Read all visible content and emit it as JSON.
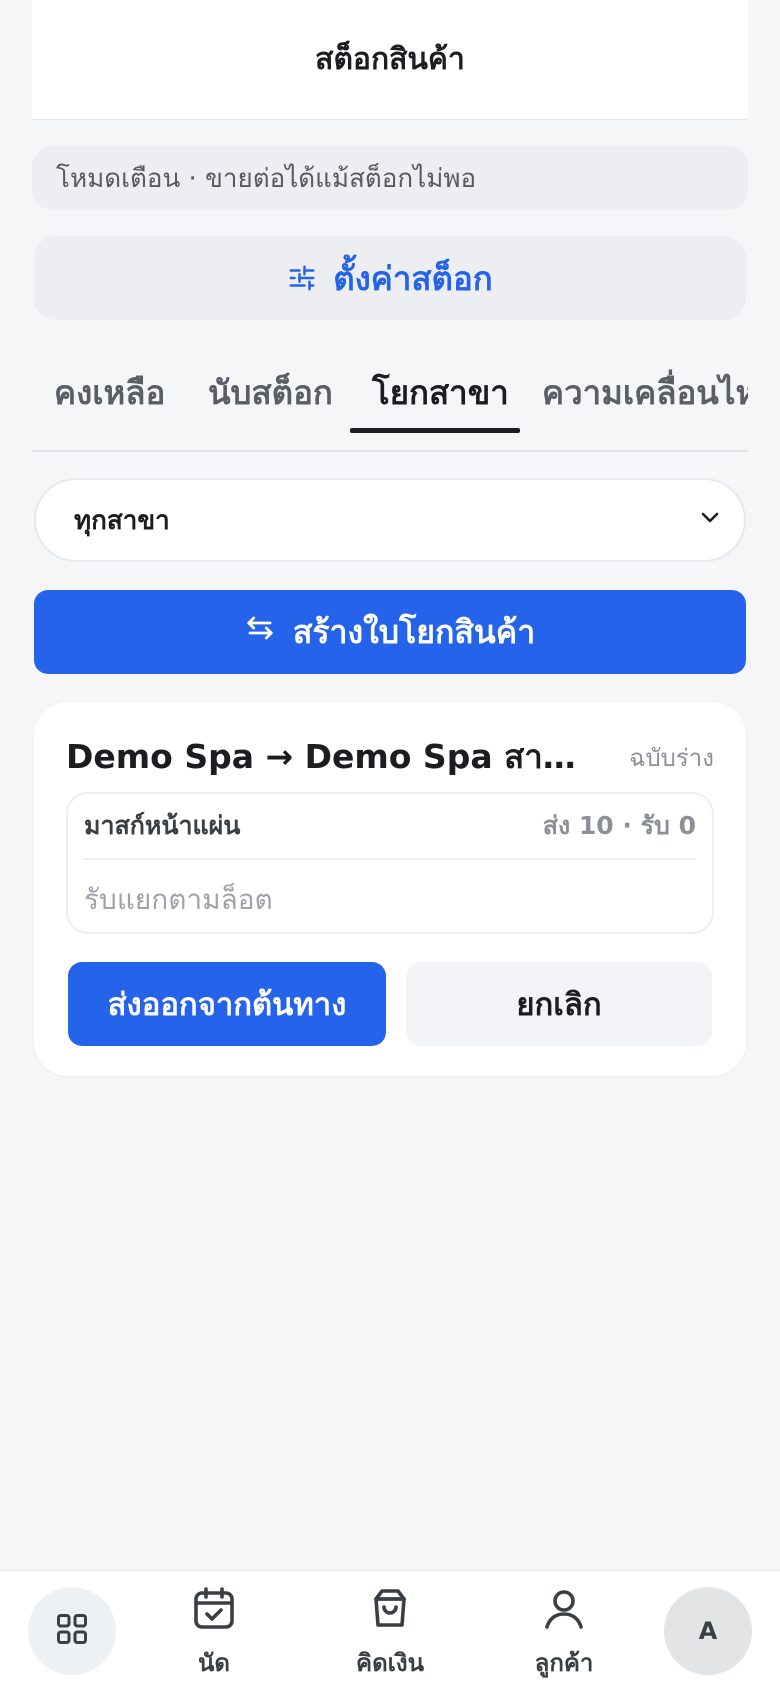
{
  "header": {
    "title": "สต็อกสินค้า"
  },
  "mode_banner": {
    "text": "โหมดเตือน · ขายต่อได้แม้สต็อกไม่พอ"
  },
  "settings_button": {
    "label": "ตั้งค่าสต็อก",
    "icon": "sliders-icon"
  },
  "tabs": [
    {
      "label": "คงเหลือ",
      "active": false
    },
    {
      "label": "นับสต็อก",
      "active": false
    },
    {
      "label": "โยกสาขา",
      "active": true
    },
    {
      "label": "ความเคลื่อนไหว",
      "active": false
    }
  ],
  "branch_filter": {
    "selected": "ทุกสาขา",
    "icon": "chevron-down-icon"
  },
  "create_button": {
    "label": "สร้างใบโยกสินค้า",
    "icon": "swap-arrows-icon"
  },
  "transfer": {
    "route": "Demo Spa → Demo Spa สาขาลาดพร้าว",
    "status": "ฉบับร่าง",
    "item_name": "มาสก์หน้าแผ่น",
    "item_qty": "ส่ง 10 · รับ 0",
    "lot_note": "รับแยกตามล็อต",
    "ship_label": "ส่งออกจากต้นทาง",
    "cancel_label": "ยกเลิก"
  },
  "bottom_nav": {
    "appointments": "นัด",
    "checkout": "คิดเงิน",
    "customers": "ลูกค้า",
    "avatar_initial": "A"
  },
  "colors": {
    "accent": "#2563eb",
    "background": "#f4f6f8",
    "surface": "#ffffff",
    "muted_surface": "#eceef1"
  }
}
